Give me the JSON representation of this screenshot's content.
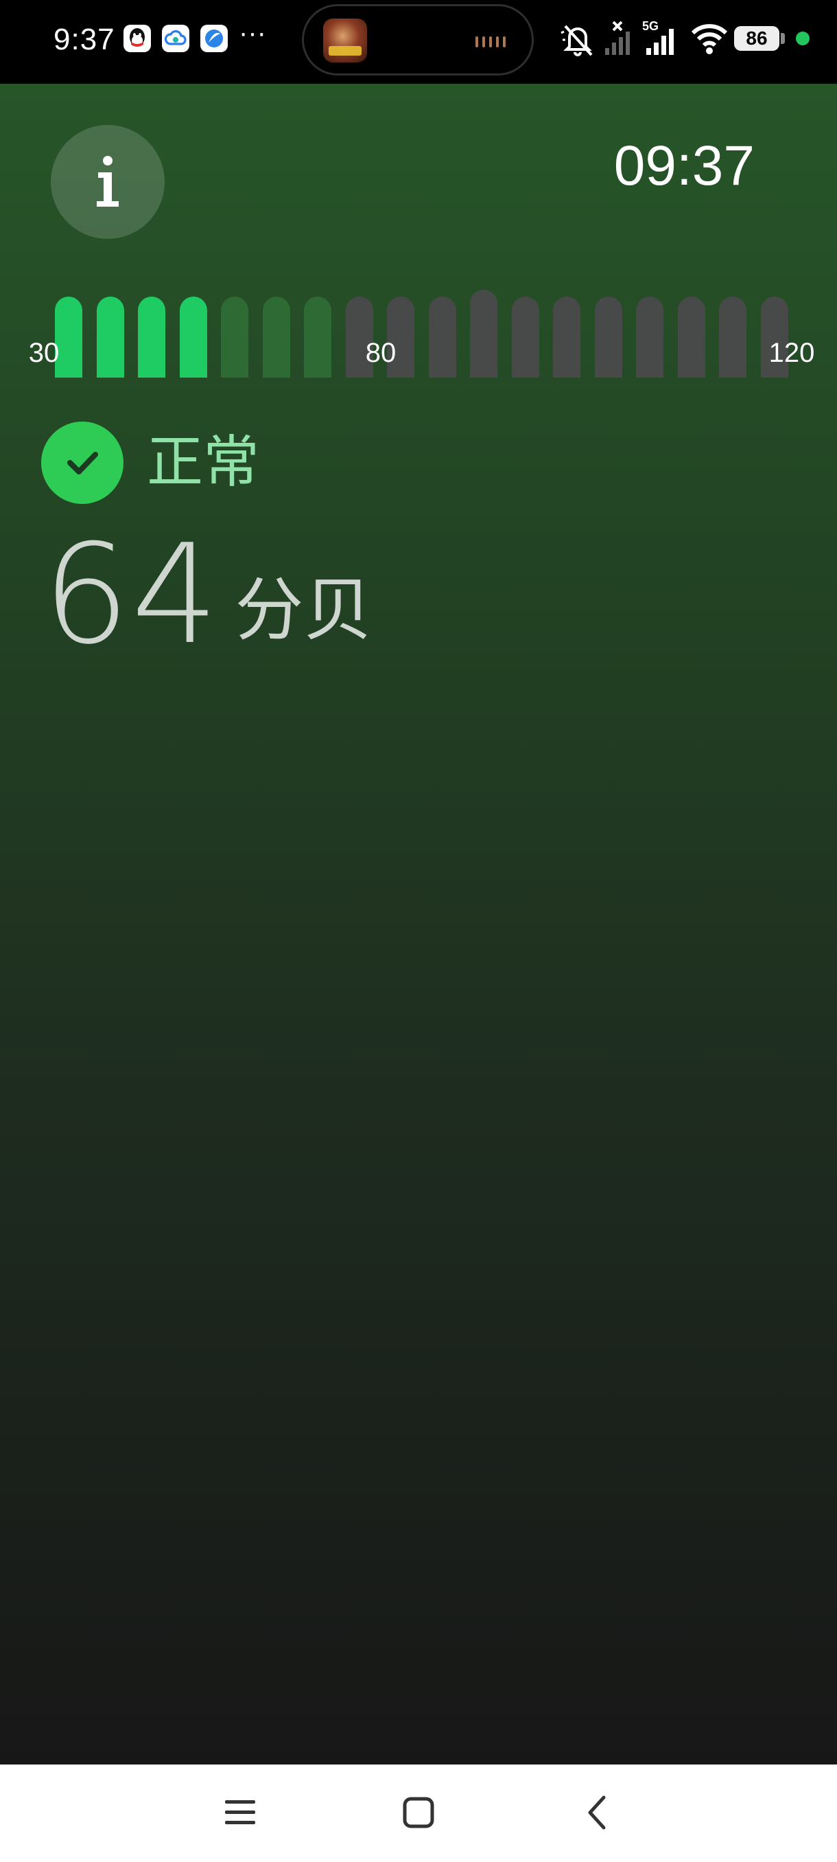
{
  "status_bar": {
    "time": "9:37",
    "more_indicator": "···",
    "battery_level": "86",
    "notification_icons": [
      "qq-icon",
      "cloud-icon",
      "browser-icon"
    ],
    "right_icons": [
      "mute-icon",
      "signal-off-icon",
      "5g-signal-icon",
      "wifi-icon"
    ]
  },
  "app": {
    "clock": "09:37",
    "info_icon": "info-icon",
    "status": {
      "icon": "check-icon",
      "label": "正常",
      "color": "#2ecc55"
    },
    "reading": {
      "value": "64",
      "unit": "分贝"
    },
    "meter": {
      "scale_labels": [
        "30",
        "80",
        "120"
      ],
      "bar_count": 18,
      "bright_bars": 4,
      "dim_green_bars": 3,
      "colors": {
        "bright": "#1fcc64",
        "dim_green": "#2e6a34",
        "inactive": "#484a49"
      }
    }
  },
  "nav_bar": {
    "icons": [
      "menu-icon",
      "home-icon",
      "back-icon"
    ]
  }
}
